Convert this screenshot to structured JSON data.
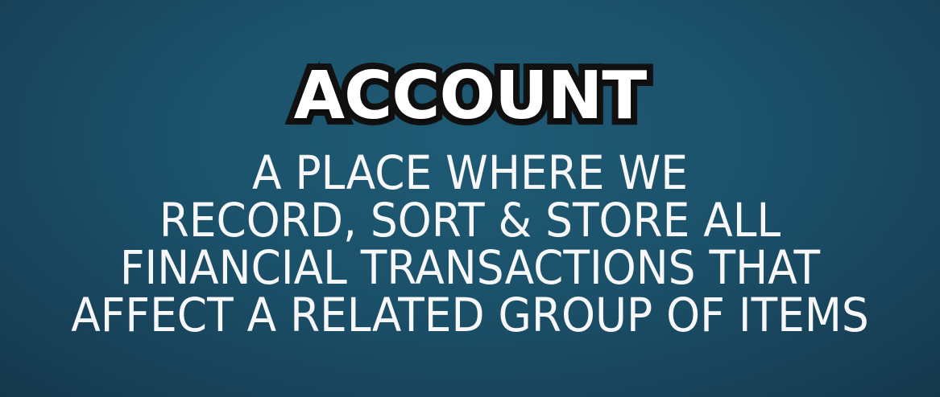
{
  "slide": {
    "title": "ACCOUNT",
    "definition_lines": [
      "A PLACE WHERE WE",
      "RECORD, SORT & STORE ALL",
      "FINANCIAL TRANSACTIONS THAT",
      "AFFECT A RELATED GROUP OF ITEMS"
    ]
  },
  "colors": {
    "background": "#1b5069",
    "title_fill": "#ffffff",
    "title_outline": "#111111",
    "text": "#f7f7f7"
  }
}
